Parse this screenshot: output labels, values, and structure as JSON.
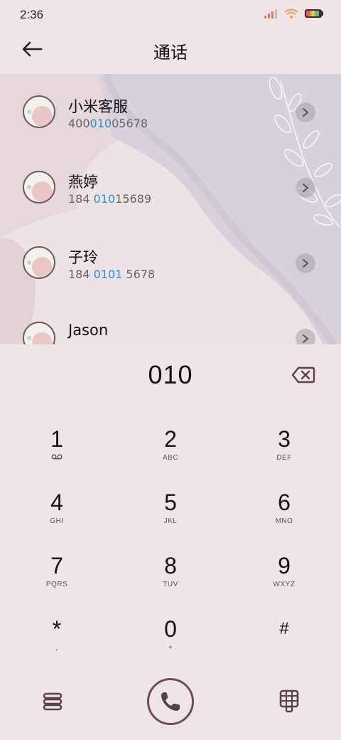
{
  "status": {
    "time": "2:36",
    "icons": [
      "signal-icon",
      "wifi-icon",
      "battery-icon"
    ]
  },
  "header": {
    "title": "通话",
    "back_icon": "arrow-left-icon"
  },
  "results": [
    {
      "name": "小米客服",
      "num_pre": "400",
      "num_hl": "010",
      "num_post": "05678"
    },
    {
      "name": "燕婷",
      "num_pre": "184 ",
      "num_hl": "010",
      "num_post": "15689"
    },
    {
      "name": "子玲",
      "num_pre": "184 ",
      "num_hl": "0101",
      "num_post": " 5678"
    },
    {
      "name": "Jason",
      "num_pre": "",
      "num_hl": "",
      "num_post": ""
    }
  ],
  "dialer": {
    "input": "010",
    "keys": [
      {
        "main": "1",
        "sub": "voicemail-icon"
      },
      {
        "main": "2",
        "sub": "ABC"
      },
      {
        "main": "3",
        "sub": "DEF"
      },
      {
        "main": "4",
        "sub": "GHI"
      },
      {
        "main": "5",
        "sub": "JKL"
      },
      {
        "main": "6",
        "sub": "MNO"
      },
      {
        "main": "7",
        "sub": "PQRS"
      },
      {
        "main": "8",
        "sub": "TUV"
      },
      {
        "main": "9",
        "sub": "WXYZ"
      },
      {
        "main": "*",
        "sub": ","
      },
      {
        "main": "0",
        "sub": "+"
      },
      {
        "main": "#",
        "sub": ""
      }
    ]
  },
  "colors": {
    "background": "#efe4e6",
    "highlight": "#2a8fd6",
    "call_ring": "#6b4f56"
  }
}
